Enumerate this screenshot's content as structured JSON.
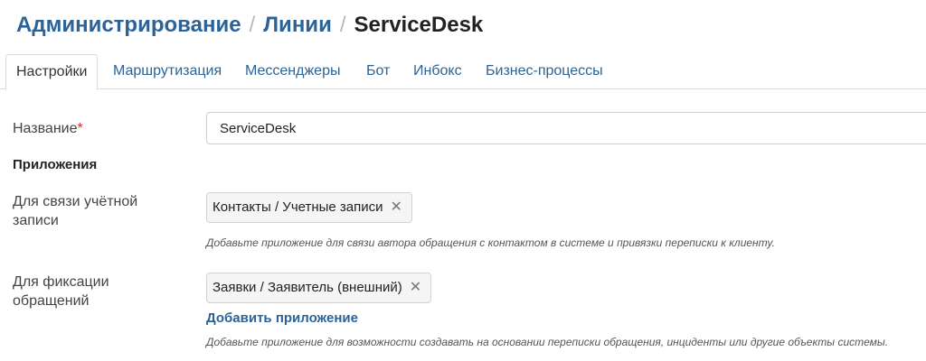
{
  "breadcrumb": {
    "items": [
      "Администрирование",
      "Линии"
    ],
    "separator": "/",
    "current": "ServiceDesk"
  },
  "tabs": [
    {
      "label": "Настройки",
      "active": true
    },
    {
      "label": "Маршрутизация",
      "active": false
    },
    {
      "label": "Мессенджеры",
      "active": false
    },
    {
      "label": "Бот",
      "active": false
    },
    {
      "label": "Инбокс",
      "active": false
    },
    {
      "label": "Бизнес-процессы",
      "active": false
    }
  ],
  "form": {
    "name_label": "Название",
    "required_mark": "*",
    "name_value": "ServiceDesk",
    "apps_section_title": "Приложения",
    "account_label_line1": "Для связи учётной",
    "account_label_line2": "записи",
    "account_chip": "Контакты / Учетные записи",
    "account_hint": "Добавьте приложение для связи автора обращения с контактом в системе и привязки переписки к клиенту.",
    "requests_label_line1": "Для фиксации",
    "requests_label_line2": "обращений",
    "requests_chip": "Заявки / Заявитель (внешний)",
    "add_app_link": "Добавить приложение",
    "requests_hint": "Добавьте приложение для возможности создавать на основании переписки обращения, инциденты или другие объекты системы.",
    "remove_icon": "close-icon"
  },
  "colors": {
    "link": "#2c6396",
    "required": "#d0312d"
  }
}
